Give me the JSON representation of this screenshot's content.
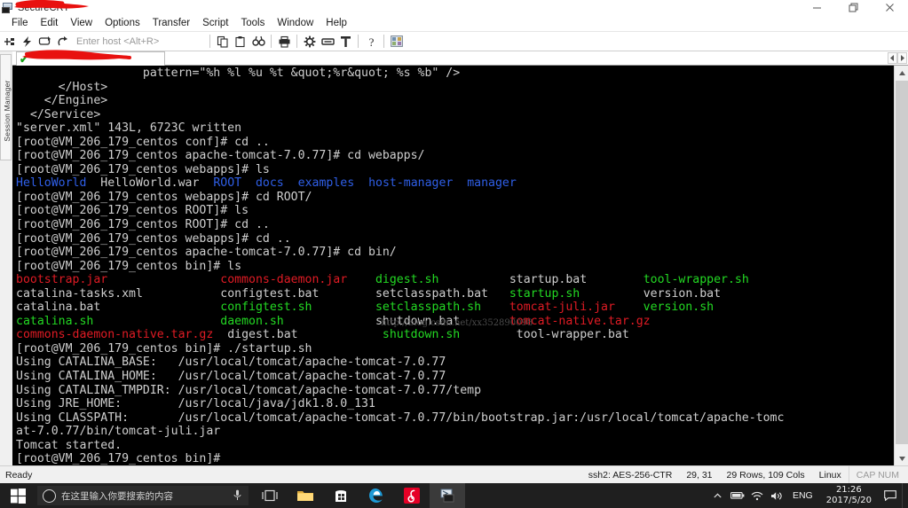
{
  "window": {
    "title_suffix": "SecureCRT",
    "title_redacted": true,
    "controls": {
      "minimize": "minimize-button",
      "restore": "restore-button",
      "close": "close-button"
    }
  },
  "menubar": {
    "items": [
      {
        "label": "File"
      },
      {
        "label": "Edit"
      },
      {
        "label": "View"
      },
      {
        "label": "Options"
      },
      {
        "label": "Transfer"
      },
      {
        "label": "Script"
      },
      {
        "label": "Tools"
      },
      {
        "label": "Window"
      },
      {
        "label": "Help"
      }
    ]
  },
  "toolbar": {
    "host_placeholder": "Enter host <Alt+R>",
    "icons": [
      "connect-icon",
      "quick-connect-icon",
      "connect-in-tab-icon",
      "reconnect-icon",
      "copy-icon",
      "paste-icon",
      "find-icon",
      "print-icon",
      "session-options-icon",
      "keymap-editor-icon",
      "filter-icon",
      "help-icon",
      "tile-icon"
    ]
  },
  "sidebar": {
    "label": "Session Manager"
  },
  "tabs": {
    "active": {
      "status_glyph": "✔",
      "label": "",
      "redacted": true
    },
    "scroll_left": "tab-scroll-left",
    "scroll_right": "tab-scroll-right"
  },
  "terminal": {
    "watermark": "http://blog.csdn.net/xx352890098",
    "lines": [
      [
        {
          "t": "                  pattern=\"%h %l %u %t &quot;%r&quot; %s %b\" />",
          "c": "white"
        }
      ],
      [
        {
          "t": "      </Host>",
          "c": "white"
        }
      ],
      [
        {
          "t": "    </Engine>",
          "c": "white"
        }
      ],
      [
        {
          "t": "  </Service>",
          "c": "white"
        }
      ],
      [
        {
          "t": "\"server.xml\" 143L, 6723C written",
          "c": "white"
        }
      ],
      [
        {
          "t": "[root@VM_206_179_centos conf]# cd ..",
          "c": "white"
        }
      ],
      [
        {
          "t": "[root@VM_206_179_centos apache-tomcat-7.0.77]# cd webapps/",
          "c": "white"
        }
      ],
      [
        {
          "t": "[root@VM_206_179_centos webapps]# ls",
          "c": "white"
        }
      ],
      [
        {
          "t": "HelloWorld",
          "c": "blue"
        },
        {
          "t": "  HelloWorld.war  ",
          "c": "white"
        },
        {
          "t": "ROOT",
          "c": "blue"
        },
        {
          "t": "  ",
          "c": "white"
        },
        {
          "t": "docs",
          "c": "blue"
        },
        {
          "t": "  ",
          "c": "white"
        },
        {
          "t": "examples",
          "c": "blue"
        },
        {
          "t": "  ",
          "c": "white"
        },
        {
          "t": "host-manager",
          "c": "blue"
        },
        {
          "t": "  ",
          "c": "white"
        },
        {
          "t": "manager",
          "c": "blue"
        }
      ],
      [
        {
          "t": "[root@VM_206_179_centos webapps]# cd ROOT/",
          "c": "white"
        }
      ],
      [
        {
          "t": "[root@VM_206_179_centos ROOT]# ls",
          "c": "white"
        }
      ],
      [
        {
          "t": "[root@VM_206_179_centos ROOT]# cd ..",
          "c": "white"
        }
      ],
      [
        {
          "t": "[root@VM_206_179_centos webapps]# cd ..",
          "c": "white"
        }
      ],
      [
        {
          "t": "[root@VM_206_179_centos apache-tomcat-7.0.77]# cd bin/",
          "c": "white"
        }
      ],
      [
        {
          "t": "[root@VM_206_179_centos bin]# ls",
          "c": "white"
        }
      ],
      [
        {
          "t": "bootstrap.jar",
          "c": "red"
        },
        {
          "t": "                ",
          "c": "white"
        },
        {
          "t": "commons-daemon.jar",
          "c": "red"
        },
        {
          "t": "    ",
          "c": "white"
        },
        {
          "t": "digest.sh",
          "c": "green"
        },
        {
          "t": "          ",
          "c": "white"
        },
        {
          "t": "startup.bat",
          "c": "white"
        },
        {
          "t": "        ",
          "c": "white"
        },
        {
          "t": "tool-wrapper.sh",
          "c": "green"
        }
      ],
      [
        {
          "t": "catalina-tasks.xml",
          "c": "white"
        },
        {
          "t": "           ",
          "c": "white"
        },
        {
          "t": "configtest.bat",
          "c": "white"
        },
        {
          "t": "        ",
          "c": "white"
        },
        {
          "t": "setclasspath.bat",
          "c": "white"
        },
        {
          "t": "   ",
          "c": "white"
        },
        {
          "t": "startup.sh",
          "c": "green"
        },
        {
          "t": "         ",
          "c": "white"
        },
        {
          "t": "version.bat",
          "c": "white"
        }
      ],
      [
        {
          "t": "catalina.bat",
          "c": "white"
        },
        {
          "t": "                 ",
          "c": "white"
        },
        {
          "t": "configtest.sh",
          "c": "green"
        },
        {
          "t": "         ",
          "c": "white"
        },
        {
          "t": "setclasspath.sh",
          "c": "green"
        },
        {
          "t": "    ",
          "c": "white"
        },
        {
          "t": "tomcat-juli.jar",
          "c": "red"
        },
        {
          "t": "    ",
          "c": "white"
        },
        {
          "t": "version.sh",
          "c": "green"
        }
      ],
      [
        {
          "t": "catalina.sh",
          "c": "green"
        },
        {
          "t": "                  ",
          "c": "white"
        },
        {
          "t": "daemon.sh",
          "c": "green"
        },
        {
          "t": "             ",
          "c": "white"
        },
        {
          "t": "shutdown.bat",
          "c": "white"
        },
        {
          "t": "       ",
          "c": "white"
        },
        {
          "t": "tomcat-native.tar.gz",
          "c": "red"
        }
      ],
      [
        {
          "t": "commons-daemon-native.tar.gz",
          "c": "red"
        },
        {
          "t": "  ",
          "c": "white"
        },
        {
          "t": "digest.bat",
          "c": "white"
        },
        {
          "t": "            ",
          "c": "white"
        },
        {
          "t": "shutdown.sh",
          "c": "green"
        },
        {
          "t": "        ",
          "c": "white"
        },
        {
          "t": "tool-wrapper.bat",
          "c": "white"
        }
      ],
      [
        {
          "t": "[root@VM_206_179_centos bin]# ./startup.sh",
          "c": "white"
        }
      ],
      [
        {
          "t": "Using CATALINA_BASE:   /usr/local/tomcat/apache-tomcat-7.0.77",
          "c": "white"
        }
      ],
      [
        {
          "t": "Using CATALINA_HOME:   /usr/local/tomcat/apache-tomcat-7.0.77",
          "c": "white"
        }
      ],
      [
        {
          "t": "Using CATALINA_TMPDIR: /usr/local/tomcat/apache-tomcat-7.0.77/temp",
          "c": "white"
        }
      ],
      [
        {
          "t": "Using JRE_HOME:        /usr/local/java/jdk1.8.0_131",
          "c": "white"
        }
      ],
      [
        {
          "t": "Using CLASSPATH:       /usr/local/tomcat/apache-tomcat-7.0.77/bin/bootstrap.jar:/usr/local/tomcat/apache-tomc",
          "c": "white"
        }
      ],
      [
        {
          "t": "at-7.0.77/bin/tomcat-juli.jar",
          "c": "white"
        }
      ],
      [
        {
          "t": "Tomcat started.",
          "c": "white"
        }
      ],
      [
        {
          "t": "[root@VM_206_179_centos bin]# ",
          "c": "white"
        }
      ]
    ]
  },
  "statusbar": {
    "ready": "Ready",
    "cipher": "ssh2: AES-256-CTR",
    "cursor": "29, 31",
    "dimensions": "29 Rows, 109 Cols",
    "emulation": "Linux",
    "caps_num": "CAP NUM"
  },
  "taskbar": {
    "start": "start-button",
    "search_placeholder": "在这里输入你要搜索的内容",
    "apps": [
      {
        "name": "task-view-icon"
      },
      {
        "name": "file-explorer-icon"
      },
      {
        "name": "microsoft-store-icon"
      },
      {
        "name": "edge-browser-icon"
      },
      {
        "name": "netease-music-icon"
      },
      {
        "name": "securecrt-icon"
      }
    ],
    "tray": {
      "lang": "ENG",
      "time": "21:26",
      "date": "2017/5/20"
    }
  },
  "colors": {
    "terminal_bg": "#000000",
    "terminal_fg": "#cccccc",
    "dir_blue": "#2f5fe8",
    "archive_red": "#e01b24",
    "exec_green": "#23d923",
    "chrome_bg": "#ffffff",
    "taskbar_bg": "#1f1f1f",
    "redaction_red": "#e8110f"
  }
}
